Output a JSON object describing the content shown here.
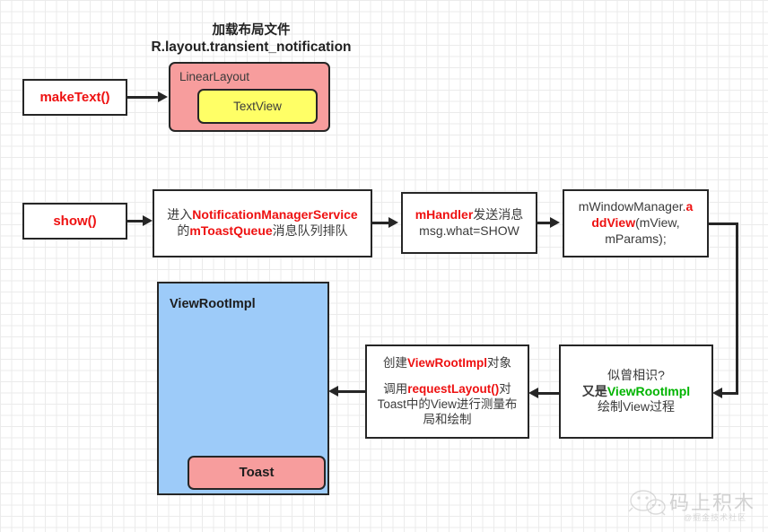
{
  "diagram": {
    "title": {
      "line1": "加载布局文件",
      "line2": "R.layout.transient_notification"
    },
    "nodes": {
      "make_text": {
        "label": "makeText()"
      },
      "linear_layout": {
        "label": "LinearLayout"
      },
      "text_view": {
        "label": "TextView"
      },
      "show": {
        "label": "show()"
      },
      "nms": {
        "line1_a": "进入",
        "line1_b": "NotificationManagerService",
        "line2_a": "的",
        "line2_b": "mToastQueue",
        "line2_c": "消息队列排队"
      },
      "handler": {
        "line1_a": "mHandler",
        "line1_b": "发送消息",
        "line2": "msg.what=SHOW"
      },
      "window_manager": {
        "line1_a": "mWindowManager.",
        "line1_b": "a",
        "line2_a": "ddView",
        "line2_b": "(mView,",
        "line3": "mParams);"
      },
      "view_root_impl": {
        "label": "ViewRootImpl"
      },
      "toast": {
        "label": "Toast"
      },
      "create_vri": {
        "line1_a": "创建",
        "line1_b": "ViewRootImpl",
        "line1_c": "对象",
        "line2_a": "调用",
        "line2_b": "requestLayout()",
        "line2_c": "对",
        "line3": "Toast中的View进行测量布",
        "line4": "局和绘制"
      },
      "dejavu": {
        "line1": "似曾相识?",
        "line2_a": "又是",
        "line2_b": "ViewRootImpl",
        "line3": "绘制View过程"
      }
    },
    "watermark": {
      "text": "码上积木",
      "subtitle": "@掘金技术社区"
    },
    "colors": {
      "accent_red": "#ee1111",
      "accent_green": "#00b400",
      "linear_layout_fill": "#f79d9d",
      "text_view_fill": "#ffff66",
      "view_root_fill": "#9dcbf9",
      "toast_fill": "#f79d9d",
      "stroke": "#262626",
      "grid_line": "#ebebeb"
    }
  }
}
